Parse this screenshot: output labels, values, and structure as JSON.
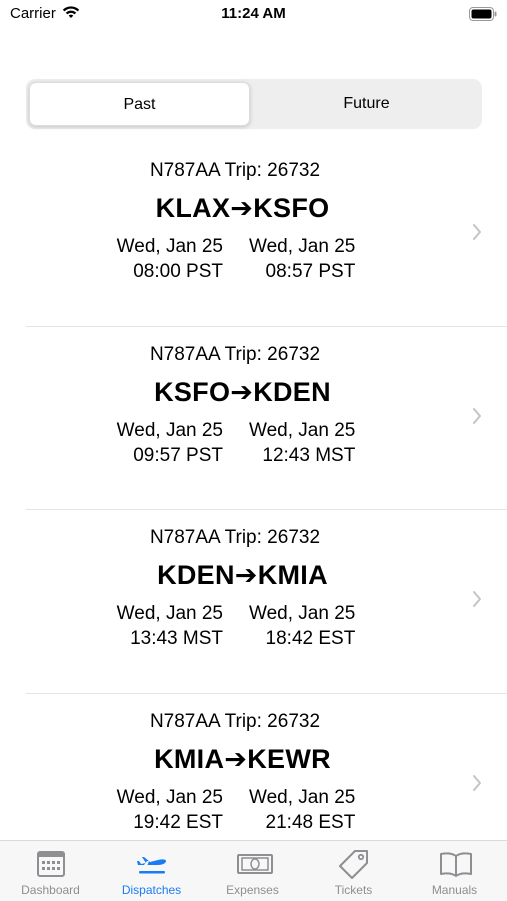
{
  "status": {
    "carrier": "Carrier",
    "time": "11:24 AM"
  },
  "segments": {
    "past": "Past",
    "future": "Future"
  },
  "trips": [
    {
      "header": "N787AA Trip: 26732",
      "origin": "KLAX",
      "dest": "KSFO",
      "dep_date": "Wed, Jan 25",
      "dep_time": "08:00 PST",
      "arr_date": "Wed, Jan 25",
      "arr_time": "08:57 PST"
    },
    {
      "header": "N787AA Trip: 26732",
      "origin": "KSFO",
      "dest": "KDEN",
      "dep_date": "Wed, Jan 25",
      "dep_time": "09:57 PST",
      "arr_date": "Wed, Jan 25",
      "arr_time": "12:43 MST"
    },
    {
      "header": "N787AA Trip: 26732",
      "origin": "KDEN",
      "dest": "KMIA",
      "dep_date": "Wed, Jan 25",
      "dep_time": "13:43 MST",
      "arr_date": "Wed, Jan 25",
      "arr_time": "18:42 EST"
    },
    {
      "header": "N787AA Trip: 26732",
      "origin": "KMIA",
      "dest": "KEWR",
      "dep_date": "Wed, Jan 25",
      "dep_time": "19:42 EST",
      "arr_date": "Wed, Jan 25",
      "arr_time": "21:48 EST"
    }
  ],
  "tabs": [
    {
      "label": "Dashboard",
      "icon": "dashboard-icon"
    },
    {
      "label": "Dispatches",
      "icon": "airplane-icon"
    },
    {
      "label": "Expenses",
      "icon": "money-icon"
    },
    {
      "label": "Tickets",
      "icon": "tag-icon"
    },
    {
      "label": "Manuals",
      "icon": "book-icon"
    }
  ],
  "active_tab": "Dispatches",
  "colors": {
    "accent": "#1a7cf5",
    "inactive": "#8e8e93"
  }
}
